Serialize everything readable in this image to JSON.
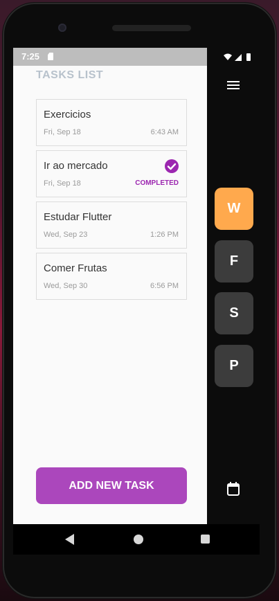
{
  "status_bar": {
    "time": "7:25"
  },
  "header": {
    "title": "TASKS LIST"
  },
  "tasks": [
    {
      "name": "Exercicios",
      "date": "Fri, Sep 18",
      "time": "6:43 AM"
    },
    {
      "name": "Ir ao mercado",
      "date": "Fri, Sep 18",
      "status": "COMPLETED"
    },
    {
      "name": "Estudar Flutter",
      "date": "Wed, Sep 23",
      "time": "1:26 PM"
    },
    {
      "name": "Comer Frutas",
      "date": "Wed, Sep 30",
      "time": "6:56 PM"
    }
  ],
  "add_button": {
    "label": "ADD NEW TASK"
  },
  "side_menu": {
    "letters": [
      {
        "label": "W",
        "active": true
      },
      {
        "label": "F",
        "active": false
      },
      {
        "label": "S",
        "active": false
      },
      {
        "label": "P",
        "active": false
      }
    ]
  },
  "colors": {
    "accent": "#ab47bc",
    "completed": "#9c27b0",
    "active_letter": "#ffa94d",
    "inactive_letter": "#3c3c3c"
  },
  "icons": [
    "sd-card-icon",
    "wifi-icon",
    "signal-icon",
    "battery-icon",
    "check-circle-icon",
    "menu-icon",
    "calendar-icon",
    "back-icon",
    "home-icon",
    "recents-icon"
  ]
}
